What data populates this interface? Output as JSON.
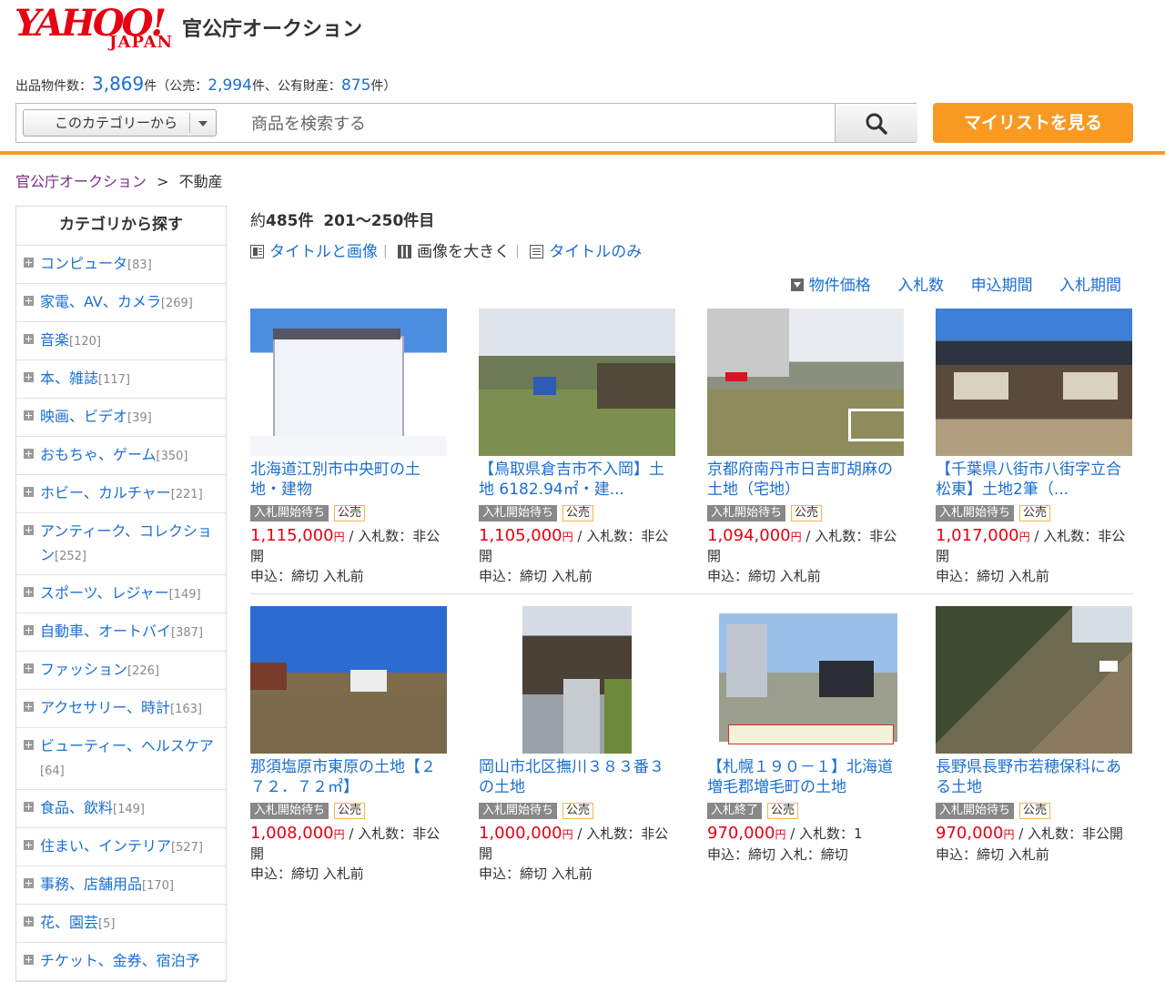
{
  "header": {
    "logo_text": "YAHOO!",
    "logo_sub": "JAPAN",
    "site_title": "官公庁オークション"
  },
  "counts": {
    "label": "出品物件数：",
    "total": "3,869",
    "unit": "件",
    "open_paren": "（公売：",
    "public_sale": "2,994",
    "mid": "件、公有財産：",
    "public_property": "875",
    "close": "件）"
  },
  "search": {
    "category_select": "このカテゴリーから",
    "placeholder": "商品を検索する"
  },
  "mylist_button": "マイリストを見る",
  "breadcrumb": {
    "root": "官公庁オークション",
    "sep": ">",
    "current": "不動産"
  },
  "sidebar": {
    "title": "カテゴリから探す",
    "items": [
      {
        "label": "コンピュータ",
        "count": "[83]"
      },
      {
        "label": "家電、AV、カメラ",
        "count": "[269]"
      },
      {
        "label": "音楽",
        "count": "[120]"
      },
      {
        "label": "本、雑誌",
        "count": "[117]"
      },
      {
        "label": "映画、ビデオ",
        "count": "[39]"
      },
      {
        "label": "おもちゃ、ゲーム",
        "count": "[350]"
      },
      {
        "label": "ホビー、カルチャー",
        "count": "[221]"
      },
      {
        "label": "アンティーク、コレクション",
        "count": "[252]"
      },
      {
        "label": "スポーツ、レジャー",
        "count": "[149]"
      },
      {
        "label": "自動車、オートバイ",
        "count": "[387]"
      },
      {
        "label": "ファッション",
        "count": "[226]"
      },
      {
        "label": "アクセサリー、時計",
        "count": "[163]"
      },
      {
        "label": "ビューティー、ヘルスケア",
        "count": "[64]"
      },
      {
        "label": "食品、飲料",
        "count": "[149]"
      },
      {
        "label": "住まい、インテリア",
        "count": "[527]"
      },
      {
        "label": "事務、店舗用品",
        "count": "[170]"
      },
      {
        "label": "花、園芸",
        "count": "[5]"
      },
      {
        "label": "チケット、金券、宿泊予",
        "count": ""
      }
    ]
  },
  "results": {
    "approx": "約",
    "count": "485件",
    "range": "201〜250件目"
  },
  "view_modes": {
    "title_and_image": "タイトルと画像",
    "large_image": "画像を大きく",
    "title_only": "タイトルのみ"
  },
  "sort": {
    "price": "物件価格",
    "bids": "入札数",
    "apply_period": "申込期間",
    "bid_period": "入札期間"
  },
  "listings": [
    {
      "title": "北海道江別市中央町の土地・建物",
      "status": "入札開始待ち",
      "kind": "公売",
      "price": "1,115,000",
      "yen": "円",
      "bids": " / 入札数：非公開",
      "apply": "申込：締切 入札前"
    },
    {
      "title": "【鳥取県倉吉市不入岡】土地 6182.94㎡・建...",
      "status": "入札開始待ち",
      "kind": "公売",
      "price": "1,105,000",
      "yen": "円",
      "bids": " / 入札数：非公開",
      "apply": "申込：締切 入札前"
    },
    {
      "title": "京都府南丹市日吉町胡麻の土地（宅地）",
      "status": "入札開始待ち",
      "kind": "公売",
      "price": "1,094,000",
      "yen": "円",
      "bids": " / 入札数：非公開",
      "apply": "申込：締切 入札前"
    },
    {
      "title": "【千葉県八街市八街字立合松東】土地2筆（...",
      "status": "入札開始待ち",
      "kind": "公売",
      "price": "1,017,000",
      "yen": "円",
      "bids": " / 入札数：非公開",
      "apply": "申込：締切 入札前"
    },
    {
      "title": "那須塩原市東原の土地【２７２．７２㎡】",
      "status": "入札開始待ち",
      "kind": "公売",
      "price": "1,008,000",
      "yen": "円",
      "bids": " / 入札数：非公開",
      "apply": "申込：締切 入札前"
    },
    {
      "title": "岡山市北区撫川３８３番３の土地",
      "status": "入札開始待ち",
      "kind": "公売",
      "price": "1,000,000",
      "yen": "円",
      "bids": " / 入札数：非公開",
      "apply": "申込：締切 入札前"
    },
    {
      "title": "【札幌１９０－１】北海道増毛郡増毛町の土地",
      "status": "入札終了",
      "kind": "公売",
      "price": "970,000",
      "yen": "円",
      "bids": " / 入札数：1",
      "apply": "申込：締切 入札：締切"
    },
    {
      "title": "長野県長野市若穂保科にある土地",
      "status": "入札開始待ち",
      "kind": "公売",
      "price": "970,000",
      "yen": "円",
      "bids": " / 入札数：非公開",
      "apply": "申込：締切 入札前"
    }
  ],
  "colors": {
    "accent": "#f89a22",
    "link": "#1a6fd1",
    "price": "#e60012",
    "logo": "#e60012"
  }
}
